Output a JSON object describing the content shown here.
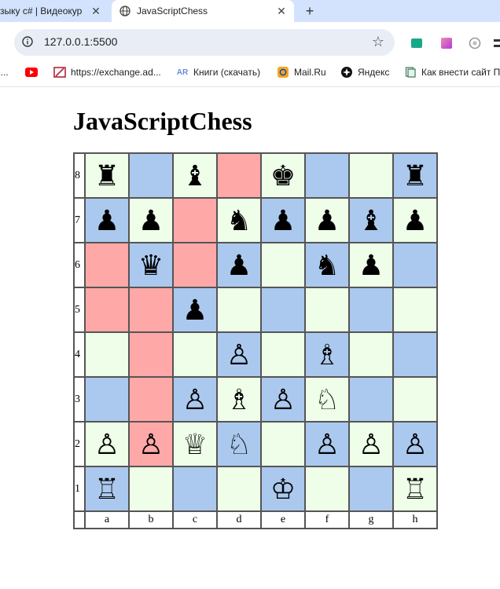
{
  "browser": {
    "tabs": [
      {
        "title": "зыку c# | Видеокур",
        "active": false
      },
      {
        "title": "JavaScriptChess",
        "active": true
      }
    ],
    "close_glyph": "✕",
    "new_tab_glyph": "+",
    "url": "127.0.0.1:5500",
    "star_glyph": "☆",
    "bookmarks": [
      {
        "label": "е...",
        "icon": "truncated"
      },
      {
        "label": "",
        "icon": "youtube-icon"
      },
      {
        "label": "https://exchange.ad...",
        "icon": "exchange-icon"
      },
      {
        "label": "Книги (скачать)",
        "icon": "ar-icon",
        "icon_text": "AR"
      },
      {
        "label": "Mail.Ru",
        "icon": "mailru-icon"
      },
      {
        "label": "Яндекс",
        "icon": "yandex-icon"
      },
      {
        "label": "Как внести сайт П",
        "icon": "page-icon"
      }
    ]
  },
  "page": {
    "title": "JavaScriptChess"
  },
  "board": {
    "colors": {
      "light": "#eefee8",
      "dark": "#abc9ee",
      "red": "#fea8a8"
    },
    "files": [
      "a",
      "b",
      "c",
      "d",
      "e",
      "f",
      "g",
      "h"
    ],
    "ranks": [
      {
        "label": "8",
        "squares": [
          {
            "piece": "♜",
            "color": "light"
          },
          {
            "piece": "",
            "color": "dark"
          },
          {
            "piece": "♝",
            "color": "light"
          },
          {
            "piece": "",
            "color": "red"
          },
          {
            "piece": "♚",
            "color": "light"
          },
          {
            "piece": "",
            "color": "dark"
          },
          {
            "piece": "",
            "color": "light"
          },
          {
            "piece": "♜",
            "color": "dark"
          }
        ]
      },
      {
        "label": "7",
        "squares": [
          {
            "piece": "♟",
            "color": "dark"
          },
          {
            "piece": "♟",
            "color": "light"
          },
          {
            "piece": "",
            "color": "red"
          },
          {
            "piece": "♞",
            "color": "light"
          },
          {
            "piece": "♟",
            "color": "dark"
          },
          {
            "piece": "♟",
            "color": "light"
          },
          {
            "piece": "♝",
            "color": "dark"
          },
          {
            "piece": "♟",
            "color": "light"
          }
        ]
      },
      {
        "label": "6",
        "squares": [
          {
            "piece": "",
            "color": "red"
          },
          {
            "piece": "♛",
            "color": "dark"
          },
          {
            "piece": "",
            "color": "red"
          },
          {
            "piece": "♟",
            "color": "dark"
          },
          {
            "piece": "",
            "color": "light"
          },
          {
            "piece": "♞",
            "color": "dark"
          },
          {
            "piece": "♟",
            "color": "light"
          },
          {
            "piece": "",
            "color": "dark"
          }
        ]
      },
      {
        "label": "5",
        "squares": [
          {
            "piece": "",
            "color": "red"
          },
          {
            "piece": "",
            "color": "red"
          },
          {
            "piece": "♟",
            "color": "dark"
          },
          {
            "piece": "",
            "color": "light"
          },
          {
            "piece": "",
            "color": "dark"
          },
          {
            "piece": "",
            "color": "light"
          },
          {
            "piece": "",
            "color": "dark"
          },
          {
            "piece": "",
            "color": "light"
          }
        ]
      },
      {
        "label": "4",
        "squares": [
          {
            "piece": "",
            "color": "light"
          },
          {
            "piece": "",
            "color": "red"
          },
          {
            "piece": "",
            "color": "light"
          },
          {
            "piece": "♙",
            "color": "dark"
          },
          {
            "piece": "",
            "color": "light"
          },
          {
            "piece": "♗",
            "color": "dark"
          },
          {
            "piece": "",
            "color": "light"
          },
          {
            "piece": "",
            "color": "dark"
          }
        ]
      },
      {
        "label": "3",
        "squares": [
          {
            "piece": "",
            "color": "dark"
          },
          {
            "piece": "",
            "color": "red"
          },
          {
            "piece": "♙",
            "color": "dark"
          },
          {
            "piece": "♗",
            "color": "light"
          },
          {
            "piece": "♙",
            "color": "dark"
          },
          {
            "piece": "♘",
            "color": "light"
          },
          {
            "piece": "",
            "color": "dark"
          },
          {
            "piece": "",
            "color": "light"
          }
        ]
      },
      {
        "label": "2",
        "squares": [
          {
            "piece": "♙",
            "color": "light"
          },
          {
            "piece": "♙",
            "color": "red"
          },
          {
            "piece": "♕",
            "color": "light"
          },
          {
            "piece": "♘",
            "color": "dark"
          },
          {
            "piece": "",
            "color": "light"
          },
          {
            "piece": "♙",
            "color": "dark"
          },
          {
            "piece": "♙",
            "color": "light"
          },
          {
            "piece": "♙",
            "color": "dark"
          }
        ]
      },
      {
        "label": "1",
        "squares": [
          {
            "piece": "♖",
            "color": "dark"
          },
          {
            "piece": "",
            "color": "light"
          },
          {
            "piece": "",
            "color": "dark"
          },
          {
            "piece": "",
            "color": "light"
          },
          {
            "piece": "♔",
            "color": "dark"
          },
          {
            "piece": "",
            "color": "light"
          },
          {
            "piece": "",
            "color": "dark"
          },
          {
            "piece": "♖",
            "color": "light"
          }
        ]
      }
    ]
  }
}
